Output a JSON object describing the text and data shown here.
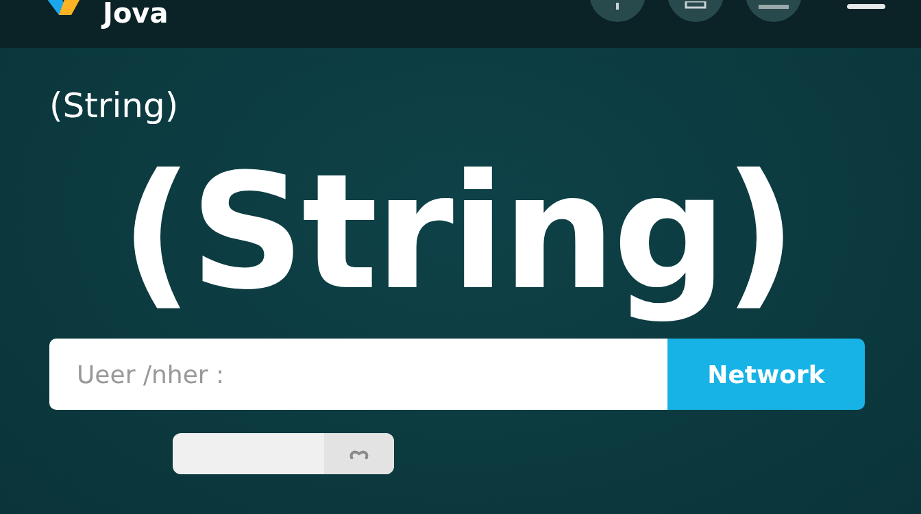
{
  "header": {
    "logo_text": "Jova"
  },
  "subtitle": "(String)",
  "headline": "(String)",
  "input": {
    "placeholder": "Ueer /nher :"
  },
  "network_button": "Network"
}
